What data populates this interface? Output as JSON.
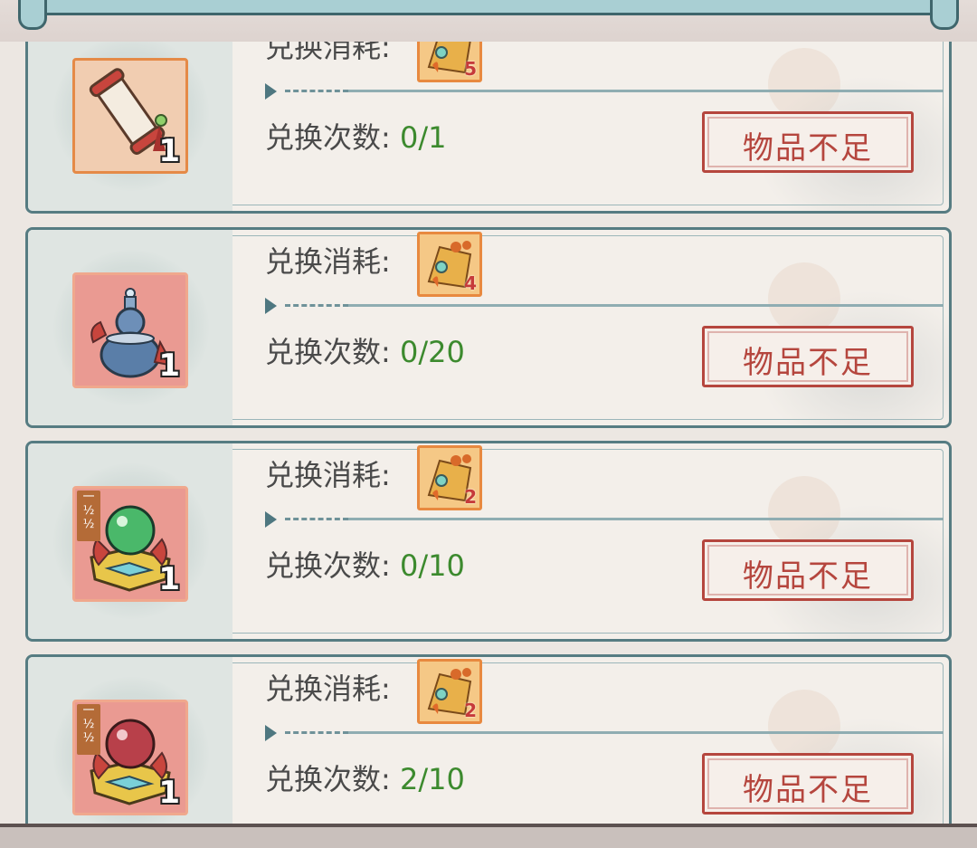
{
  "cost_label": "兑换消耗:",
  "count_label": "兑换次数:",
  "button_label": "物品不足",
  "colors": {
    "frame": "#567c82",
    "count_value": "#3c8a2e",
    "button": "#b5463e",
    "token_frame": "#e8893f"
  },
  "items": [
    {
      "icon": "scroll-icon",
      "quantity": "1",
      "cost": "5",
      "count": "0/1",
      "frame": "orange",
      "tag": ""
    },
    {
      "icon": "gourd-vase-icon",
      "quantity": "1",
      "cost": "4",
      "count": "0/20",
      "frame": "red",
      "tag": ""
    },
    {
      "icon": "green-orb-chest-icon",
      "quantity": "1",
      "cost": "2",
      "count": "0/10",
      "frame": "red",
      "tag": "一\n½\n½"
    },
    {
      "icon": "red-orb-chest-icon",
      "quantity": "1",
      "cost": "2",
      "count": "2/10",
      "frame": "red",
      "tag": "一\n½\n½"
    }
  ]
}
